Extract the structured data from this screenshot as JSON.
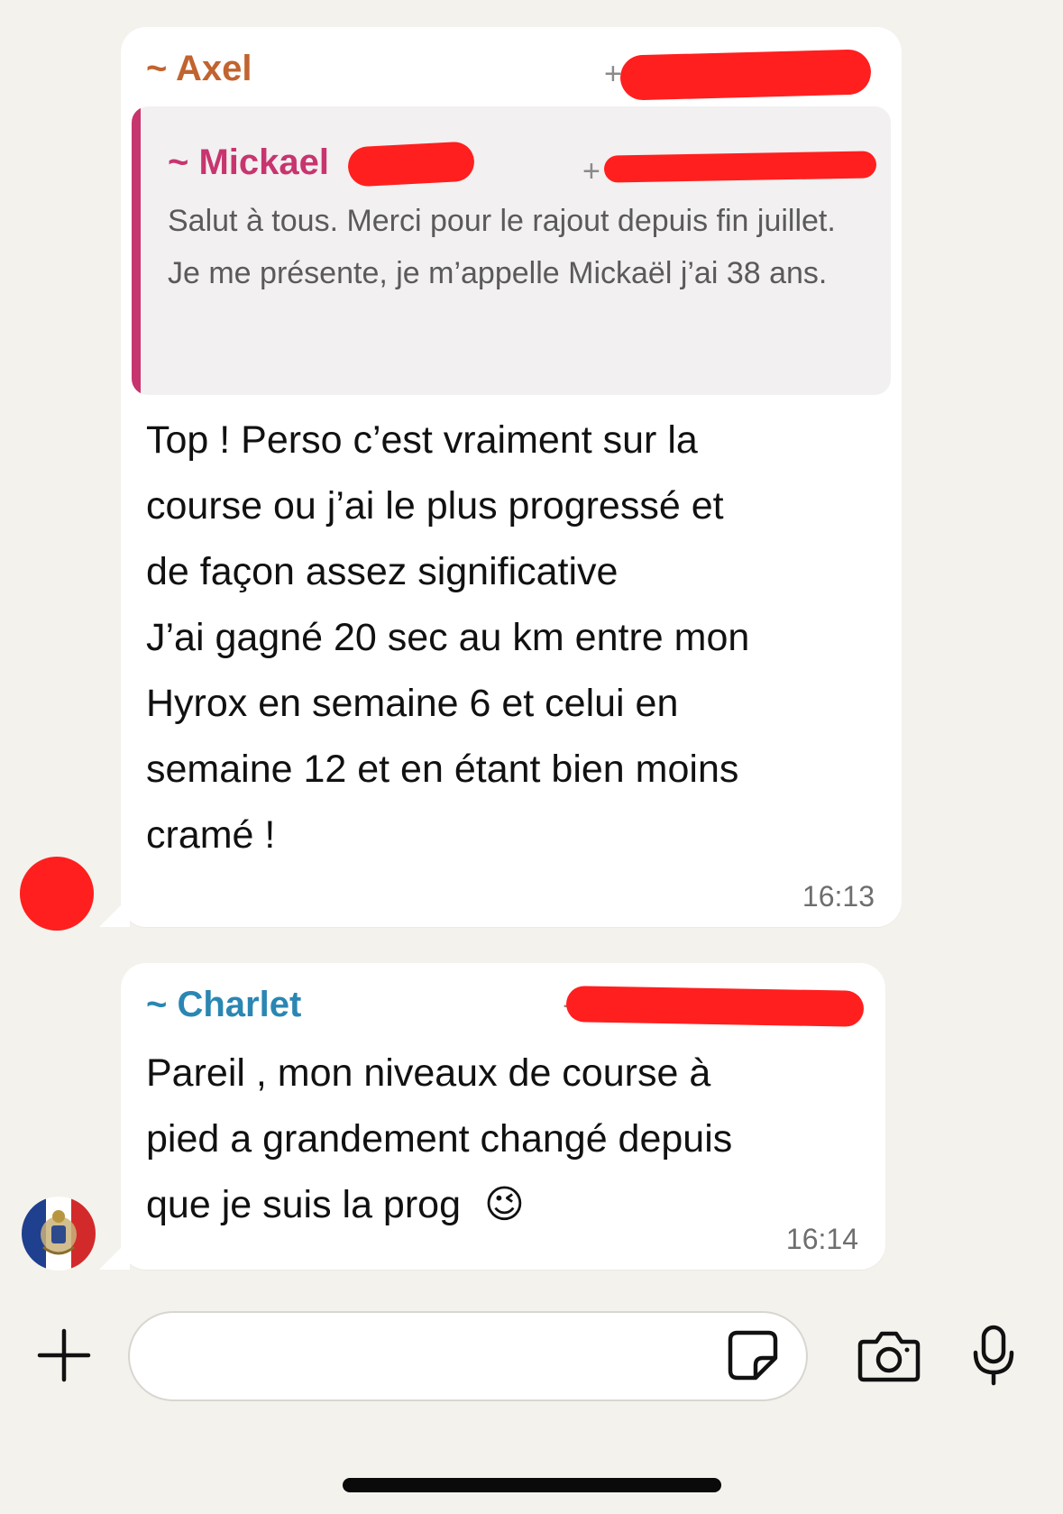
{
  "colors": {
    "background": "#f4f2ed",
    "bubble": "#ffffff",
    "axel": "#c1642f",
    "mickael": "#c7356f",
    "charlet": "#2a86b3",
    "redaction": "#ff1f1f"
  },
  "messages": [
    {
      "sender": "~ Axel",
      "phone_prefix": "+",
      "quote": {
        "sender": "~ Mickael",
        "phone_prefix": "+",
        "text": "Salut à tous. Merci pour le rajout depuis fin juillet. Je me présente, je m’appelle Mickaël j’ai 38 ans."
      },
      "text_lines": [
        "Top ! Perso c’est vraiment sur la",
        "course ou j’ai le plus progressé et",
        "de façon assez significative",
        "J’ai gagné 20 sec au km entre mon",
        "Hyrox en semaine 6 et celui en",
        "semaine 12 et en étant bien moins",
        "cramé !"
      ],
      "time": "16:13"
    },
    {
      "sender": "~ Charlet",
      "phone_prefix": "+",
      "text_lines": [
        "Pareil , mon niveaux de course à",
        "pied a grandement changé depuis",
        "que je suis la prog"
      ],
      "emoji": "😉",
      "time": "16:14"
    }
  ],
  "composer": {
    "input_value": "",
    "input_placeholder": ""
  }
}
